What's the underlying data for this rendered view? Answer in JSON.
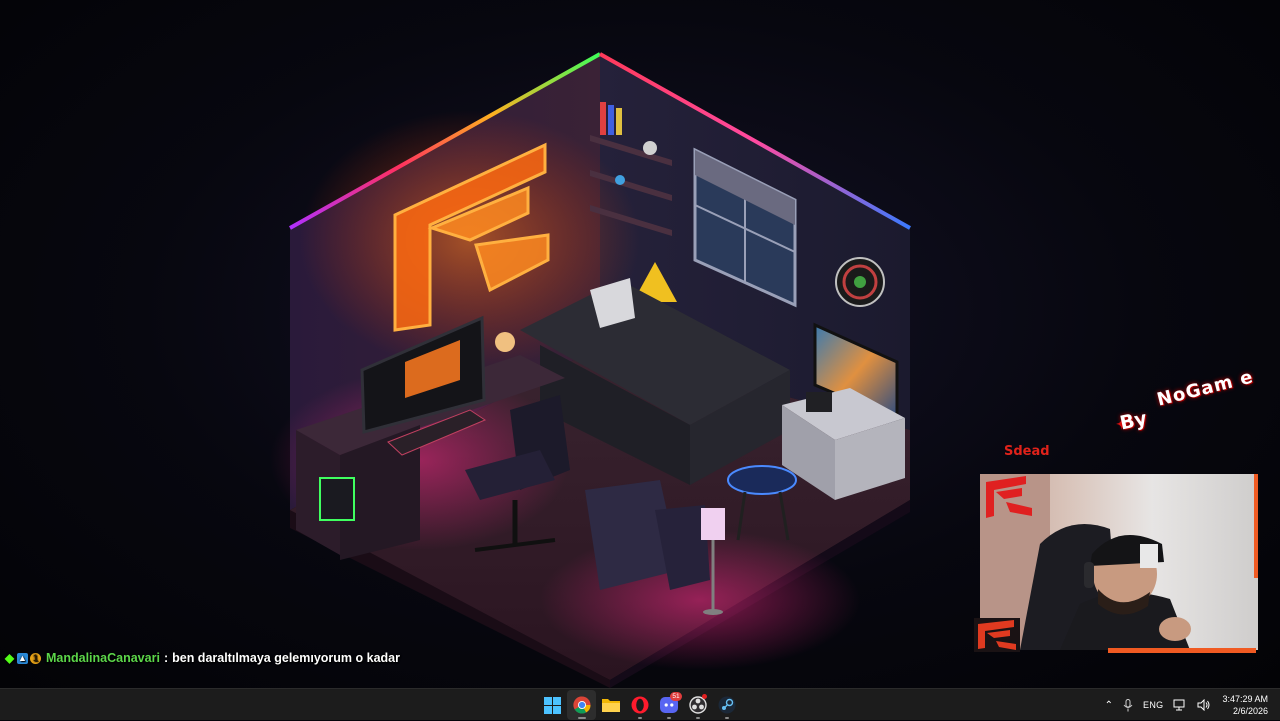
{
  "overlay": {
    "brand_by": "By",
    "brand_name": "NoGam e",
    "dead_label": "Sdead"
  },
  "chat": {
    "badges": [
      "kick-icon",
      "subscriber-badge-icon",
      "gift-badge-icon"
    ],
    "badge_gift_count": "1",
    "username": "MandalinaCanavari",
    "separator": ":",
    "message": "ben daraltılmaya gelemıyorum o kadar",
    "username_color": "#5cd64a"
  },
  "taskbar": {
    "apps": [
      {
        "name": "start",
        "icon": "windows-start-icon"
      },
      {
        "name": "chrome",
        "icon": "chrome-icon",
        "state": "active"
      },
      {
        "name": "file-explorer",
        "icon": "folder-icon"
      },
      {
        "name": "opera-gx",
        "icon": "opera-icon",
        "state": "running"
      },
      {
        "name": "discord",
        "icon": "discord-icon",
        "badge": "51",
        "state": "running"
      },
      {
        "name": "obs",
        "icon": "obs-icon",
        "state": "running"
      },
      {
        "name": "steam",
        "icon": "steam-icon",
        "state": "running"
      }
    ],
    "discord_badge": "51",
    "tray": {
      "language": "ENG",
      "time": "3:47:29 AM",
      "date": "2/6/2026"
    }
  },
  "colors": {
    "accent_orange": "#f05a22",
    "brand_red": "#e0221a",
    "taskbar_bg": "#1c1c1c"
  }
}
